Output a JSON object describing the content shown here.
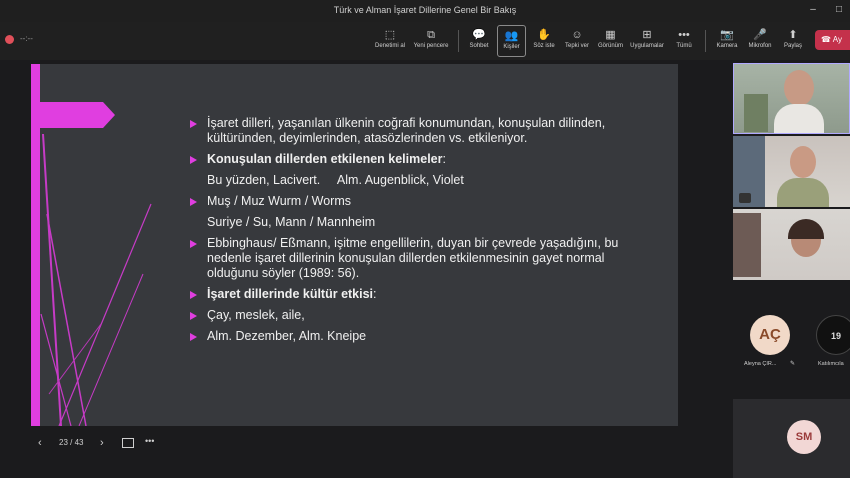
{
  "window": {
    "title": "Türk ve Alman İşaret Dillerine Genel Bir Bakış",
    "controls": [
      "–",
      "□"
    ]
  },
  "toolbar": {
    "timer": "--:--",
    "buttons": [
      {
        "id": "open-meeting",
        "label": "Denetimi al",
        "icon": "⬚"
      },
      {
        "id": "new-window",
        "label": "Yeni pencere",
        "icon": "⧉"
      },
      {
        "id": "chat",
        "label": "Sohbet",
        "icon": "💬"
      },
      {
        "id": "people",
        "label": "Kişiler",
        "icon": "👥"
      },
      {
        "id": "raise-hand",
        "label": "Söz iste",
        "icon": "✋"
      },
      {
        "id": "react",
        "label": "Tepki ver",
        "icon": "☺"
      },
      {
        "id": "view",
        "label": "Görünüm",
        "icon": "▦"
      },
      {
        "id": "apps",
        "label": "Uygulamalar",
        "icon": "⊞"
      },
      {
        "id": "more",
        "label": "Tümü",
        "icon": "•••"
      },
      {
        "id": "camera",
        "label": "Kamera",
        "icon": "📷"
      },
      {
        "id": "mic",
        "label": "Mikrofon",
        "icon": "🎤"
      },
      {
        "id": "share",
        "label": "Paylaş",
        "icon": "⬆"
      }
    ],
    "leave_label": "Ay"
  },
  "slide": {
    "accent": "#e03ee0",
    "bullets": [
      {
        "marker": true,
        "text": "İşaret dilleri, yaşanılan ülkenin coğrafi konumundan, konuşulan dilinden, kültüründen, deyimlerinden, atasözlerinden vs. etkileniyor.",
        "bold": false
      },
      {
        "marker": true,
        "text": "Konuşulan dillerden etkilenen kelimeler",
        "suffix": ":",
        "bold": true
      },
      {
        "marker": false,
        "text": "Bu yüzden, Lacivert.     Alm. Augenblick, Violet",
        "bold": false
      },
      {
        "marker": true,
        "text": "Muş / Muz Wurm / Worms",
        "bold": false
      },
      {
        "marker": false,
        "text": "Suriye / Su, Mann / Mannheim",
        "bold": false
      },
      {
        "marker": true,
        "text": "Ebbinghaus/ Eßmann, işitme engellilerin, duyan bir çevrede yaşadığını, bu nedenle işaret dillerinin konuşulan dillerden etkilenmesinin gayet normal olduğunu söyler (1989: 56).",
        "bold": false
      },
      {
        "marker": true,
        "text": "İşaret dillerinde kültür etkisi",
        "suffix": ":",
        "bold": true
      },
      {
        "marker": true,
        "text": "Çay, meslek, aile,",
        "bold": false
      },
      {
        "marker": true,
        "text": "Alm. Dezember, Alm. Kneipe",
        "bold": false
      }
    ]
  },
  "slide_nav": {
    "prev": "‹",
    "page": "23 / 43",
    "next": "›",
    "more": "•••"
  },
  "participants": {
    "avatars": [
      {
        "initials": "AÇ",
        "name": "Aleyna ÇIR...",
        "bg": "#f1d9c8",
        "fg": "#8a4a2a"
      },
      {
        "initials": "19",
        "name": "Katılımcıla",
        "bg": "#111111",
        "fg": "#dddddd"
      },
      {
        "initials": "SM",
        "name": "",
        "bg": "#f2d7d5",
        "fg": "#9a3a3a"
      }
    ]
  }
}
